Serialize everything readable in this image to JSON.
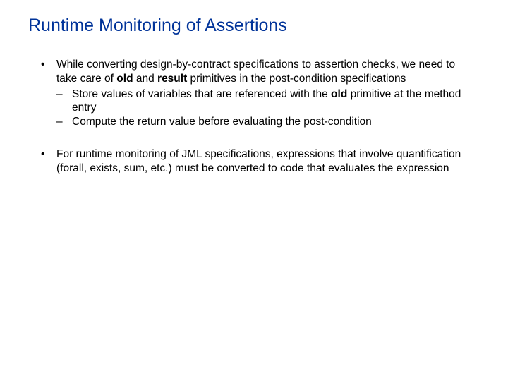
{
  "title": "Runtime Monitoring of Assertions",
  "bullets": {
    "b1": {
      "marker": "•",
      "pre": "While converting design-by-contract specifications to  assertion checks, we need to take care of ",
      "bold1": "old",
      "mid": " and ",
      "bold2": "result",
      "post": " primitives in the post-condition specifications"
    },
    "b1a": {
      "marker": "–",
      "pre": "Store values of variables that are referenced with the ",
      "bold1": "old",
      "post": " primitive at the method entry"
    },
    "b1b": {
      "marker": "–",
      "text": "Compute the return value before evaluating the post-condition"
    },
    "b2": {
      "marker": "•",
      "text": "For runtime monitoring of JML specifications, expressions that involve quantification (forall, exists, sum, etc.) must be converted to code that evaluates the expression"
    }
  }
}
